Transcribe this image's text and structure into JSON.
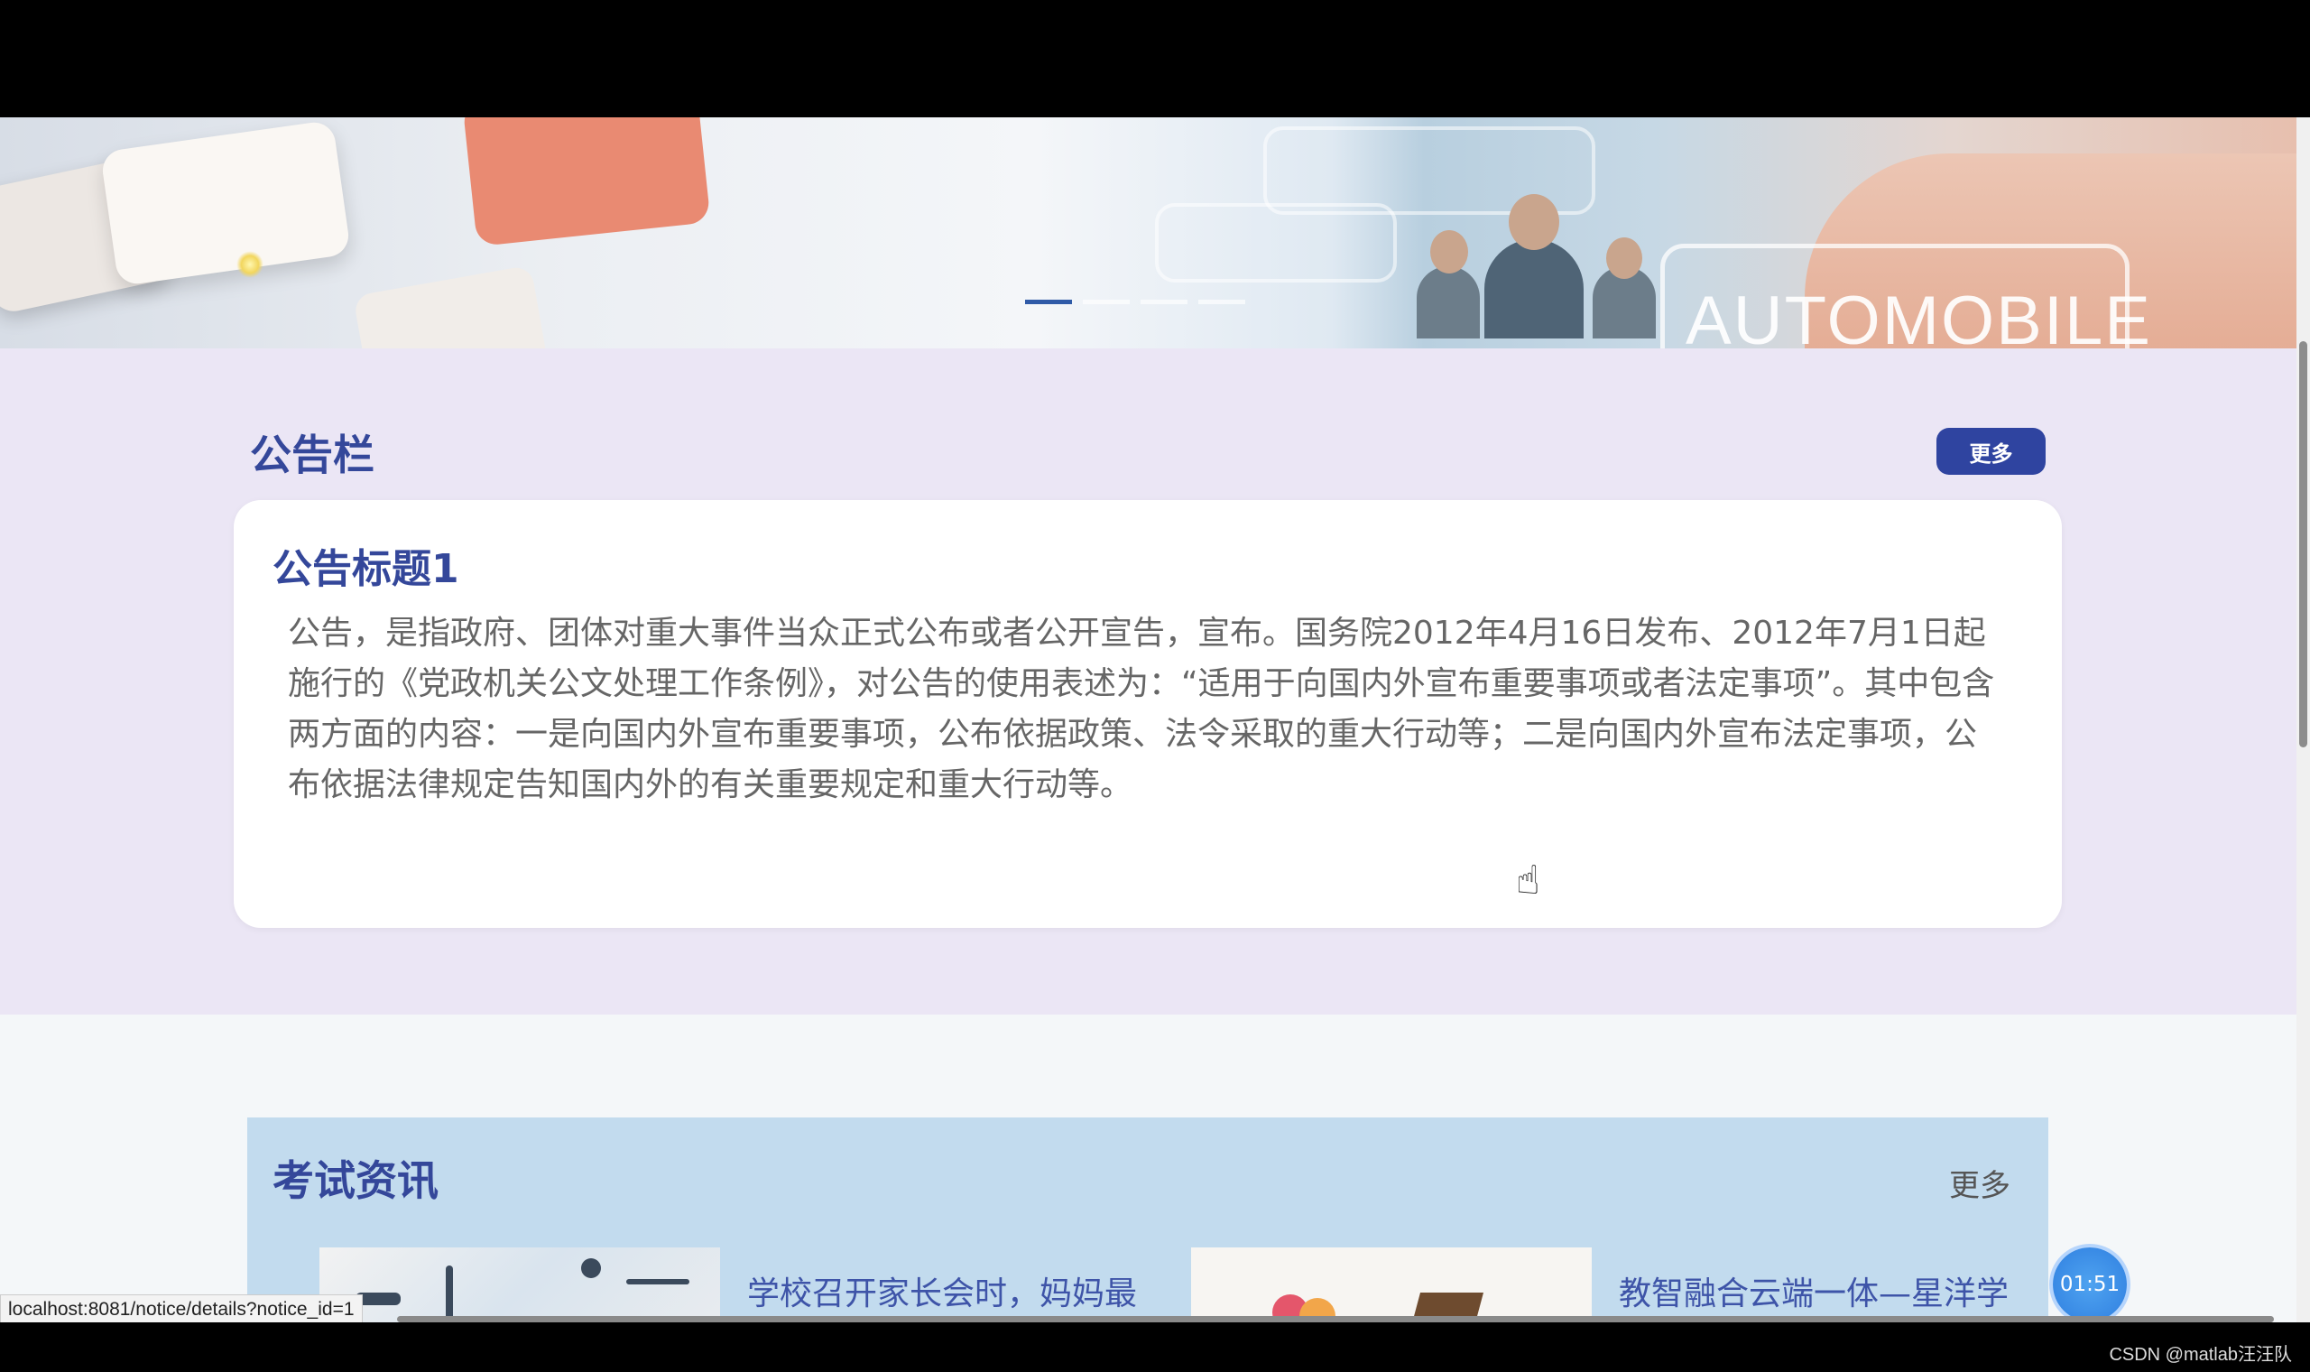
{
  "banner": {
    "image_text": "AUTOMOBILE",
    "carousel_count": 4,
    "carousel_active_index": 0
  },
  "notice": {
    "section_title": "公告栏",
    "more_label": "更多",
    "card_title": "公告标题1",
    "card_body": "公告，是指政府、团体对重大事件当众正式公布或者公开宣告，宣布。国务院2012年4月16日发布、2012年7月1日起施行的《党政机关公文处理工作条例》，对公告的使用表述为：“适用于向国内外宣布重要事项或者法定事项”。其中包含两方面的内容：一是向国内外宣布重要事项，公布依据政策、法令采取的重大行动等；二是向国内外宣布法定事项，公布依据法律规定告知国内外的有关重要规定和重大行动等。"
  },
  "exam_news": {
    "section_title": "考试资讯",
    "more_label": "更多",
    "items": [
      {
        "title": "学校召开家长会时，妈妈最"
      },
      {
        "title": "教智融合云端一体—星洋学"
      }
    ]
  },
  "timer": "01:51",
  "status_url": "localhost:8081/notice/details?notice_id=1",
  "watermark": "CSDN @matlab汪汪队"
}
